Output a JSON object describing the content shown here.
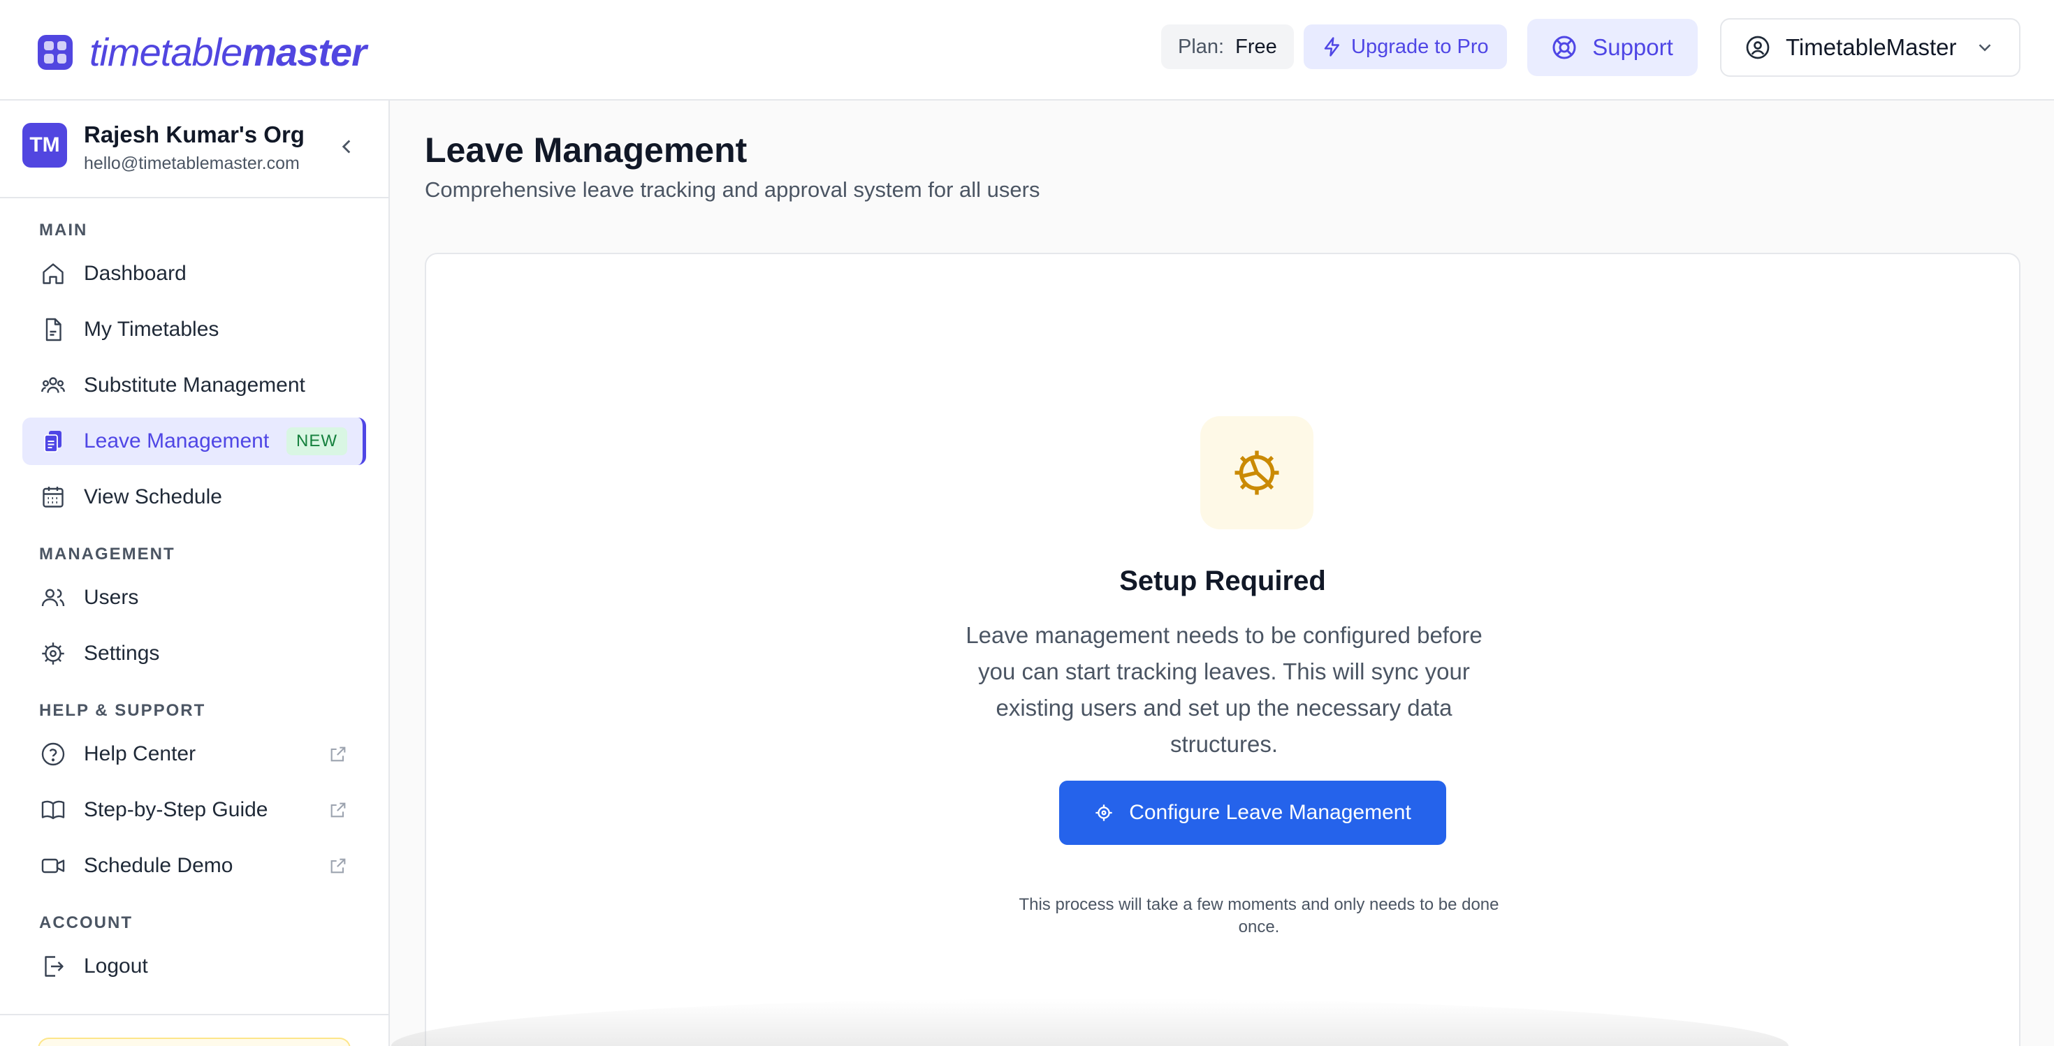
{
  "app": {
    "logo_light": "timetable",
    "logo_bold": "master"
  },
  "header": {
    "plan_label": "Plan:",
    "plan_value": "Free",
    "upgrade_label": "Upgrade to Pro",
    "support_label": "Support",
    "account_label": "TimetableMaster"
  },
  "sidebar": {
    "org_initials": "TM",
    "org_name": "Rajesh Kumar's Org",
    "org_email": "hello@timetablemaster.com",
    "sections": {
      "main": "MAIN",
      "management": "MANAGEMENT",
      "help": "HELP & SUPPORT",
      "account": "ACCOUNT"
    },
    "items": {
      "dashboard": "Dashboard",
      "my_timetables": "My Timetables",
      "substitute": "Substitute Management",
      "leave": "Leave Management",
      "leave_badge": "NEW",
      "view_schedule": "View Schedule",
      "users": "Users",
      "settings": "Settings",
      "help_center": "Help Center",
      "guide": "Step-by-Step Guide",
      "demo": "Schedule Demo",
      "logout": "Logout"
    }
  },
  "main": {
    "title": "Leave Management",
    "subtitle": "Comprehensive leave tracking and approval system for all users",
    "setup": {
      "title": "Setup Required",
      "description": "Leave management needs to be configured before you can start tracking leaves. This will sync your existing users and set up the necessary data structures.",
      "button_label": "Configure Leave Management",
      "note": "This process will take a few moments and only needs to be done once."
    }
  },
  "colors": {
    "brand": "#5146e0",
    "primary_button": "#2563eb",
    "setup_icon": "#ca8a04"
  }
}
